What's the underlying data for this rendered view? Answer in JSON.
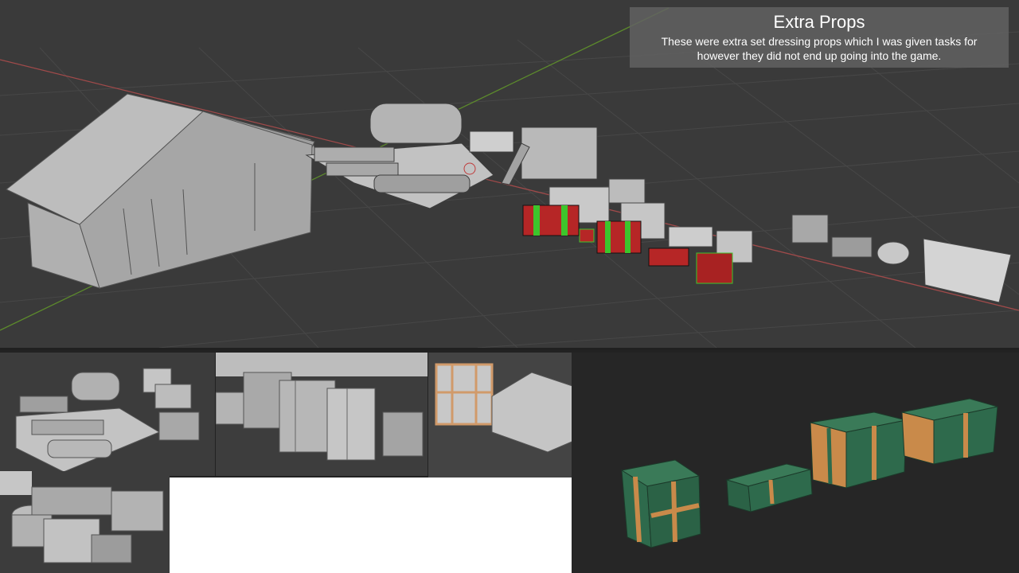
{
  "info_box": {
    "title": "Extra Props",
    "description": "These were extra set dressing props which I was given tasks for however they did not end up going into the game."
  },
  "colors": {
    "viewport_bg": "#3a3a3a",
    "grid": "#454545",
    "x_axis": "#a04a4a",
    "y_axis": "#5c8a2c",
    "mesh": "#b8b8b8",
    "crate_red": "#b62626",
    "crate_green": "#3dc52c",
    "render_green": "#2e6a4c",
    "render_orange": "#c98a4a"
  },
  "viewports": [
    {
      "name": "main-viewport",
      "content": "blockout scene"
    },
    {
      "name": "thumb-layout",
      "content": "layout overview"
    },
    {
      "name": "thumb-crates",
      "content": "crate group"
    },
    {
      "name": "thumb-closeup",
      "content": "crate closeup"
    },
    {
      "name": "thumb-barrels",
      "content": "barrels and crates"
    },
    {
      "name": "render-area",
      "content": "textured crates render"
    }
  ]
}
